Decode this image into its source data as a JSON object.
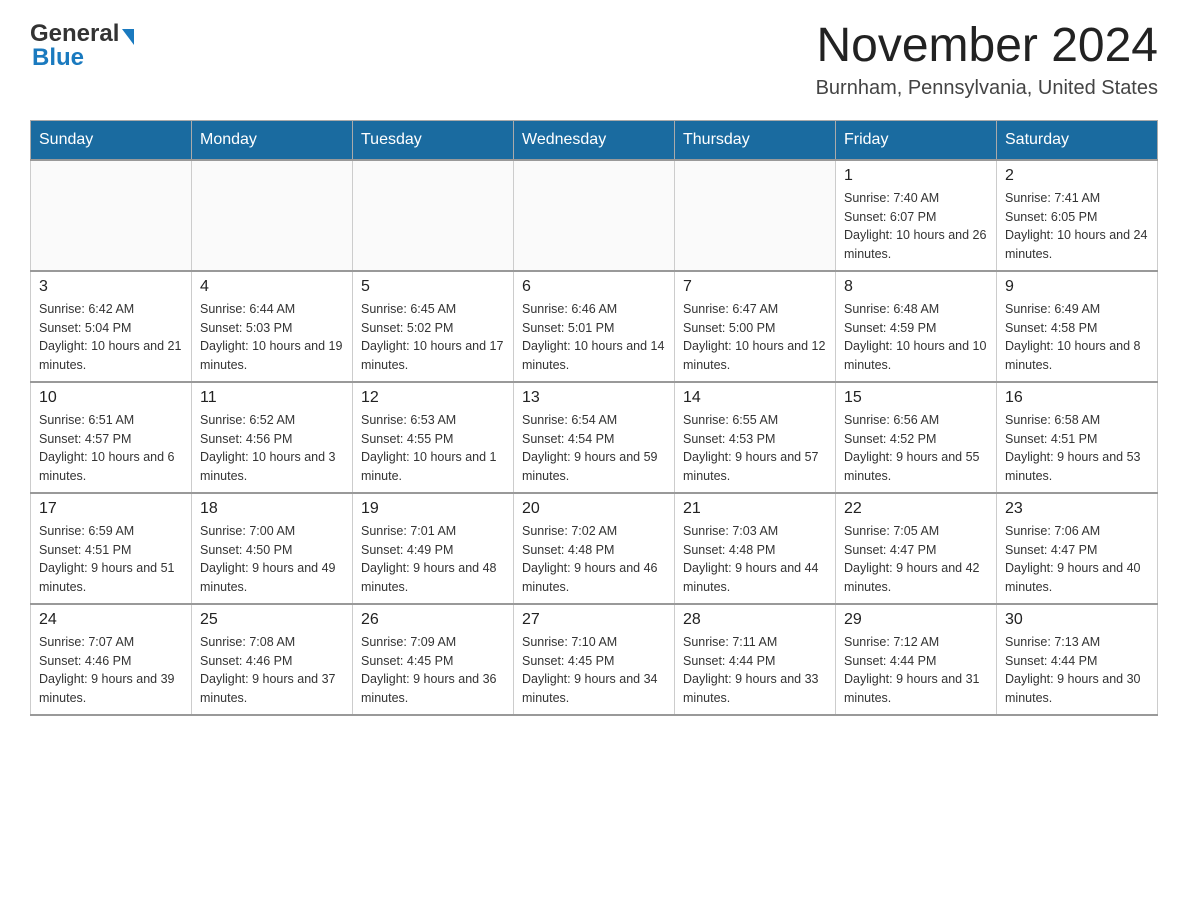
{
  "header": {
    "logo_general": "General",
    "logo_blue": "Blue",
    "title": "November 2024",
    "subtitle": "Burnham, Pennsylvania, United States"
  },
  "calendar": {
    "days_of_week": [
      "Sunday",
      "Monday",
      "Tuesday",
      "Wednesday",
      "Thursday",
      "Friday",
      "Saturday"
    ],
    "weeks": [
      [
        {
          "day": "",
          "info": ""
        },
        {
          "day": "",
          "info": ""
        },
        {
          "day": "",
          "info": ""
        },
        {
          "day": "",
          "info": ""
        },
        {
          "day": "",
          "info": ""
        },
        {
          "day": "1",
          "info": "Sunrise: 7:40 AM\nSunset: 6:07 PM\nDaylight: 10 hours and 26 minutes."
        },
        {
          "day": "2",
          "info": "Sunrise: 7:41 AM\nSunset: 6:05 PM\nDaylight: 10 hours and 24 minutes."
        }
      ],
      [
        {
          "day": "3",
          "info": "Sunrise: 6:42 AM\nSunset: 5:04 PM\nDaylight: 10 hours and 21 minutes."
        },
        {
          "day": "4",
          "info": "Sunrise: 6:44 AM\nSunset: 5:03 PM\nDaylight: 10 hours and 19 minutes."
        },
        {
          "day": "5",
          "info": "Sunrise: 6:45 AM\nSunset: 5:02 PM\nDaylight: 10 hours and 17 minutes."
        },
        {
          "day": "6",
          "info": "Sunrise: 6:46 AM\nSunset: 5:01 PM\nDaylight: 10 hours and 14 minutes."
        },
        {
          "day": "7",
          "info": "Sunrise: 6:47 AM\nSunset: 5:00 PM\nDaylight: 10 hours and 12 minutes."
        },
        {
          "day": "8",
          "info": "Sunrise: 6:48 AM\nSunset: 4:59 PM\nDaylight: 10 hours and 10 minutes."
        },
        {
          "day": "9",
          "info": "Sunrise: 6:49 AM\nSunset: 4:58 PM\nDaylight: 10 hours and 8 minutes."
        }
      ],
      [
        {
          "day": "10",
          "info": "Sunrise: 6:51 AM\nSunset: 4:57 PM\nDaylight: 10 hours and 6 minutes."
        },
        {
          "day": "11",
          "info": "Sunrise: 6:52 AM\nSunset: 4:56 PM\nDaylight: 10 hours and 3 minutes."
        },
        {
          "day": "12",
          "info": "Sunrise: 6:53 AM\nSunset: 4:55 PM\nDaylight: 10 hours and 1 minute."
        },
        {
          "day": "13",
          "info": "Sunrise: 6:54 AM\nSunset: 4:54 PM\nDaylight: 9 hours and 59 minutes."
        },
        {
          "day": "14",
          "info": "Sunrise: 6:55 AM\nSunset: 4:53 PM\nDaylight: 9 hours and 57 minutes."
        },
        {
          "day": "15",
          "info": "Sunrise: 6:56 AM\nSunset: 4:52 PM\nDaylight: 9 hours and 55 minutes."
        },
        {
          "day": "16",
          "info": "Sunrise: 6:58 AM\nSunset: 4:51 PM\nDaylight: 9 hours and 53 minutes."
        }
      ],
      [
        {
          "day": "17",
          "info": "Sunrise: 6:59 AM\nSunset: 4:51 PM\nDaylight: 9 hours and 51 minutes."
        },
        {
          "day": "18",
          "info": "Sunrise: 7:00 AM\nSunset: 4:50 PM\nDaylight: 9 hours and 49 minutes."
        },
        {
          "day": "19",
          "info": "Sunrise: 7:01 AM\nSunset: 4:49 PM\nDaylight: 9 hours and 48 minutes."
        },
        {
          "day": "20",
          "info": "Sunrise: 7:02 AM\nSunset: 4:48 PM\nDaylight: 9 hours and 46 minutes."
        },
        {
          "day": "21",
          "info": "Sunrise: 7:03 AM\nSunset: 4:48 PM\nDaylight: 9 hours and 44 minutes."
        },
        {
          "day": "22",
          "info": "Sunrise: 7:05 AM\nSunset: 4:47 PM\nDaylight: 9 hours and 42 minutes."
        },
        {
          "day": "23",
          "info": "Sunrise: 7:06 AM\nSunset: 4:47 PM\nDaylight: 9 hours and 40 minutes."
        }
      ],
      [
        {
          "day": "24",
          "info": "Sunrise: 7:07 AM\nSunset: 4:46 PM\nDaylight: 9 hours and 39 minutes."
        },
        {
          "day": "25",
          "info": "Sunrise: 7:08 AM\nSunset: 4:46 PM\nDaylight: 9 hours and 37 minutes."
        },
        {
          "day": "26",
          "info": "Sunrise: 7:09 AM\nSunset: 4:45 PM\nDaylight: 9 hours and 36 minutes."
        },
        {
          "day": "27",
          "info": "Sunrise: 7:10 AM\nSunset: 4:45 PM\nDaylight: 9 hours and 34 minutes."
        },
        {
          "day": "28",
          "info": "Sunrise: 7:11 AM\nSunset: 4:44 PM\nDaylight: 9 hours and 33 minutes."
        },
        {
          "day": "29",
          "info": "Sunrise: 7:12 AM\nSunset: 4:44 PM\nDaylight: 9 hours and 31 minutes."
        },
        {
          "day": "30",
          "info": "Sunrise: 7:13 AM\nSunset: 4:44 PM\nDaylight: 9 hours and 30 minutes."
        }
      ]
    ]
  }
}
